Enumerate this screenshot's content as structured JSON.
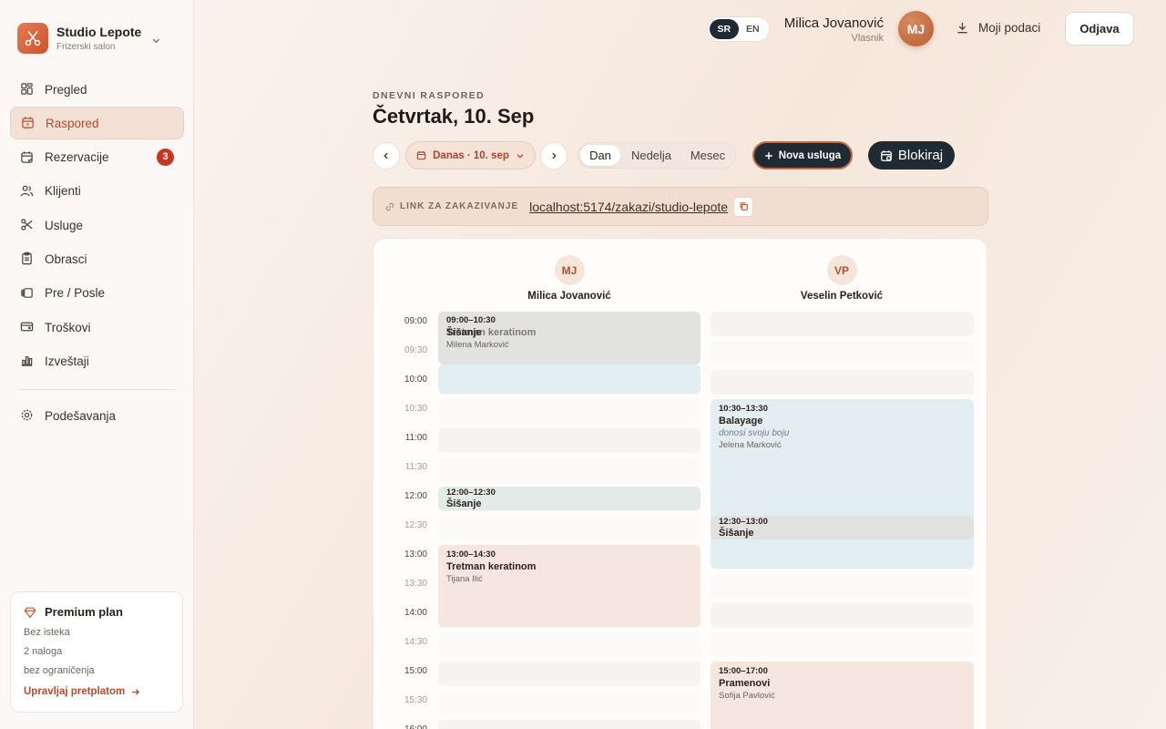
{
  "brand": {
    "name": "Studio Lepote",
    "subtitle": "Frizerski salon"
  },
  "nav": {
    "items": [
      {
        "label": "Pregled",
        "icon": "dashboard-icon"
      },
      {
        "label": "Raspored",
        "icon": "calendar-icon",
        "active": true
      },
      {
        "label": "Rezervacije",
        "icon": "calendar-check-icon",
        "badge": "3"
      },
      {
        "label": "Klijenti",
        "icon": "users-icon"
      },
      {
        "label": "Usluge",
        "icon": "scissors-icon"
      },
      {
        "label": "Obrasci",
        "icon": "clipboard-icon"
      },
      {
        "label": "Pre / Posle",
        "icon": "gallery-icon"
      },
      {
        "label": "Troškovi",
        "icon": "wallet-icon"
      },
      {
        "label": "Izveštaji",
        "icon": "chart-icon"
      }
    ],
    "settings": "Podešavanja"
  },
  "plan": {
    "title": "Premium plan",
    "lines": [
      "Bez isteka",
      "2 naloga",
      "bez ograničenja"
    ],
    "link": "Upravljaj pretplatom"
  },
  "header": {
    "lang": [
      "SR",
      "EN"
    ],
    "user_name": "Milica Jovanović",
    "user_role": "Vlasnik",
    "avatar": "MJ",
    "my_data": "Moji podaci",
    "logout": "Odjava"
  },
  "page": {
    "eyebrow": "DNEVNI RASPORED",
    "title": "Četvrtak, 10. Sep",
    "date_button": "Danas · 10. sep",
    "views": [
      "Dan",
      "Nedelja",
      "Mesec"
    ],
    "new_service": "Nova usluga",
    "block": "Blokiraj",
    "link_label": "LINK ZA ZAKAZIVANJE",
    "link_url": "localhost:5174/zakazi/studio-lepote"
  },
  "calendar": {
    "staff": [
      {
        "initials": "MJ",
        "name": "Milica Jovanović"
      },
      {
        "initials": "VP",
        "name": "Veselin Petković"
      }
    ],
    "times": [
      "09:00",
      "09:30",
      "10:00",
      "10:30",
      "11:00",
      "11:30",
      "12:00",
      "12:30",
      "13:00",
      "13:30",
      "14:00",
      "14:30",
      "15:00",
      "15:30",
      "16:00"
    ],
    "events_mj": [
      {
        "time": "09:00–10:30",
        "name": "Šišanje",
        "name2": "Tretman keratinom",
        "client": "Milena Marković",
        "color": "#e2e2e1"
      },
      {
        "time": "12:00–12:30",
        "name": "Šišanje",
        "color": "#e2ebe8"
      },
      {
        "time": "13:00–14:30",
        "name": "Tretman keratinom",
        "client": "Tijana Ilić",
        "color": "#f5e6e0"
      }
    ],
    "events_vp": [
      {
        "time": "10:30–13:30",
        "name": "Balayage",
        "note": "donosi svoju boju",
        "client": "Jelena Marković",
        "color": "#e2eef1"
      },
      {
        "time": "12:30–13:00",
        "name": "Šišanje",
        "color": "#e1e1e0"
      },
      {
        "time": "15:00–17:00",
        "name": "Pramenovi",
        "client": "Sofija Pavlović",
        "color": "#f5e6e0"
      }
    ]
  }
}
